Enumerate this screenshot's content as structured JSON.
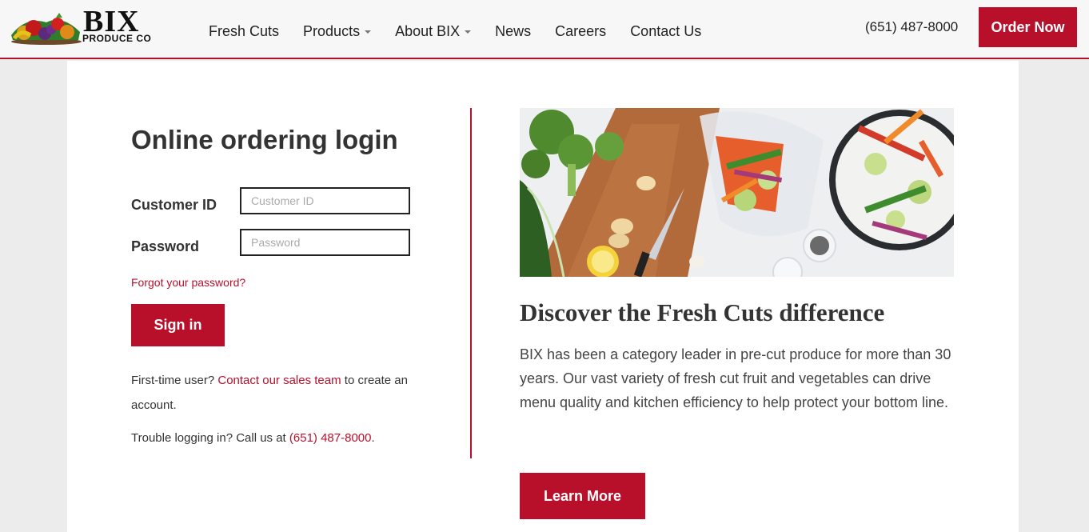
{
  "header": {
    "logo": {
      "word": "BIX",
      "sub": "PRODUCE CO"
    },
    "nav": [
      {
        "label": "Fresh Cuts",
        "dropdown": false
      },
      {
        "label": "Products",
        "dropdown": true
      },
      {
        "label": "About BIX",
        "dropdown": true
      },
      {
        "label": "News",
        "dropdown": false
      },
      {
        "label": "Careers",
        "dropdown": false
      },
      {
        "label": "Contact Us",
        "dropdown": false
      }
    ],
    "phone": "(651) 487-8000",
    "order_button": "Order Now"
  },
  "login": {
    "title": "Online ordering login",
    "customer_id_label": "Customer ID",
    "customer_id_placeholder": "Customer ID",
    "customer_id_value": "",
    "password_label": "Password",
    "password_placeholder": "Password",
    "password_value": "",
    "forgot_link": "Forgot your password?",
    "sign_in_button": "Sign in",
    "first_time_prefix": "First-time user? ",
    "first_time_link": "Contact our sales team",
    "first_time_suffix": " to create an account.",
    "trouble_prefix": "Trouble logging in? Call us at ",
    "trouble_phone": "(651) 487-8000",
    "trouble_suffix": "."
  },
  "promo": {
    "image_icon": "vegetables-image",
    "title": "Discover the Fresh Cuts difference",
    "body": "BIX has been a category leader in pre-cut produce for more than 30 years. Our vast variety of fresh cut fruit and vegetables can drive menu quality and kitchen efficiency to help protect your bottom line.",
    "learn_more_button": "Learn More"
  },
  "colors": {
    "brand_red": "#b8102b",
    "header_bg": "#f7f7f7",
    "page_bg": "#ececec"
  }
}
